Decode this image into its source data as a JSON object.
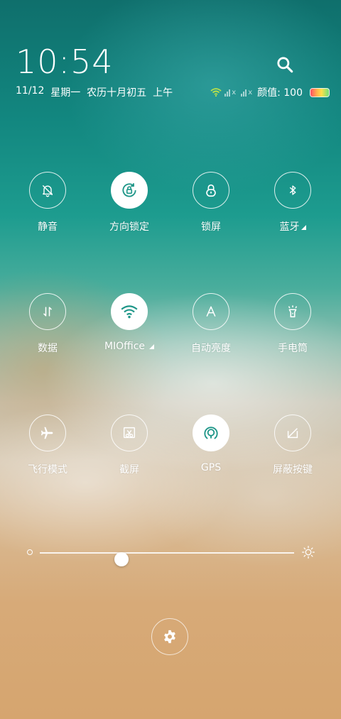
{
  "status": {
    "time": "10:54",
    "date": "11/12",
    "weekday": "星期一",
    "lunar": "农历十月初五",
    "period": "上午",
    "battery_label": "颜值: 100",
    "battery_level": 100
  },
  "toggles": [
    {
      "id": "mute",
      "label": "静音",
      "icon": "bell-off-icon",
      "on": false
    },
    {
      "id": "rotation-lock",
      "label": "方向锁定",
      "icon": "rotation-lock-icon",
      "on": true
    },
    {
      "id": "lock-screen",
      "label": "锁屏",
      "icon": "lock-icon",
      "on": false
    },
    {
      "id": "bluetooth",
      "label": "蓝牙",
      "icon": "bluetooth-icon",
      "on": false,
      "expandable": true
    },
    {
      "id": "data",
      "label": "数据",
      "icon": "data-arrows-icon",
      "on": false
    },
    {
      "id": "wifi",
      "label": "MIOffice",
      "icon": "wifi-icon",
      "on": true,
      "expandable": true
    },
    {
      "id": "auto-brightness",
      "label": "自动亮度",
      "icon": "auto-brightness-icon",
      "on": false
    },
    {
      "id": "flashlight",
      "label": "手电筒",
      "icon": "flashlight-icon",
      "on": false
    },
    {
      "id": "airplane",
      "label": "飞行模式",
      "icon": "airplane-icon",
      "on": false
    },
    {
      "id": "screenshot",
      "label": "截屏",
      "icon": "screenshot-icon",
      "on": false
    },
    {
      "id": "gps",
      "label": "GPS",
      "icon": "gps-icon",
      "on": true
    },
    {
      "id": "block-buttons",
      "label": "屏蔽按键",
      "icon": "block-buttons-icon",
      "on": false
    }
  ],
  "brightness": {
    "level": 0.32
  },
  "colors": {
    "active_icon": "#1e9688",
    "accent_wifi_status": "#b8e04a"
  }
}
